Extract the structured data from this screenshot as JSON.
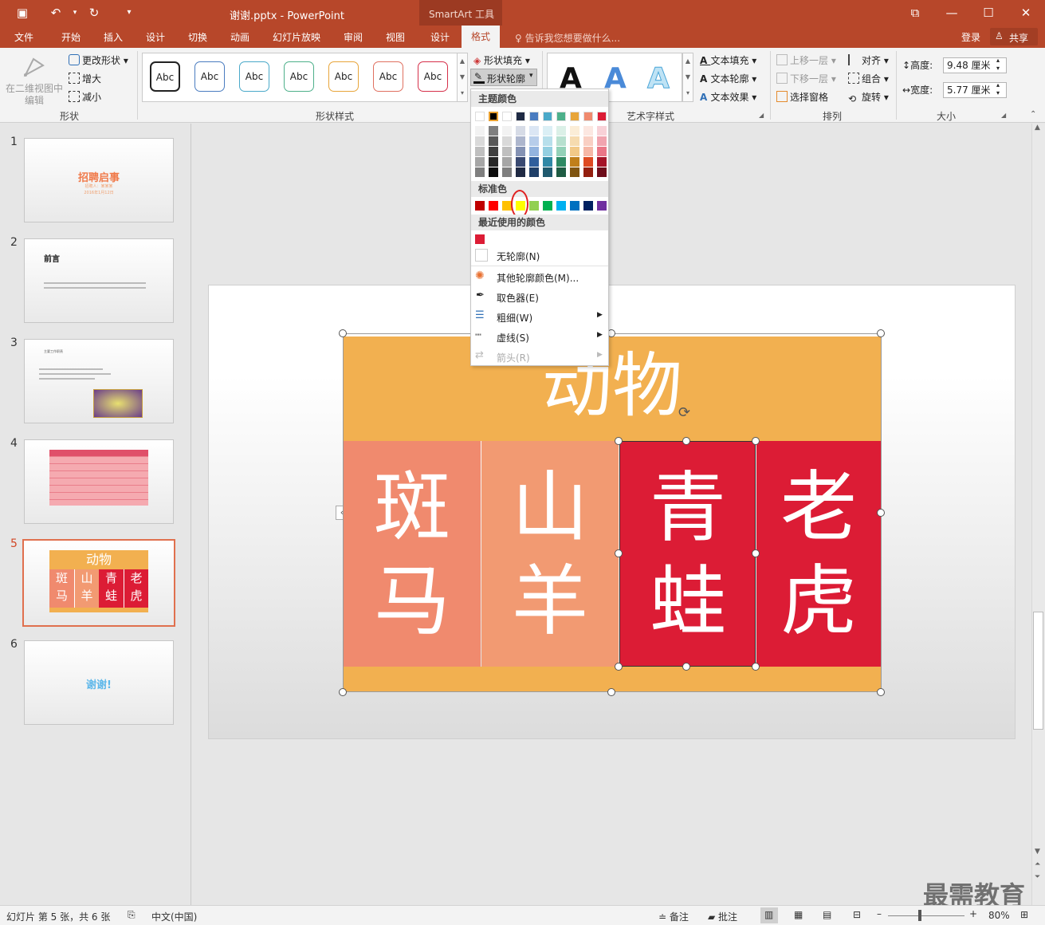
{
  "window": {
    "title": "谢谢.pptx - PowerPoint",
    "context_tab": "SmartArt 工具"
  },
  "tabs": [
    "文件",
    "开始",
    "插入",
    "设计",
    "切换",
    "动画",
    "幻灯片放映",
    "审阅",
    "视图",
    "设计",
    "格式"
  ],
  "tell_me": "告诉我您想要做什么...",
  "login": "登录",
  "share": "共享",
  "ribbon": {
    "shape_group": {
      "edit_2d": "在二维视图中编辑",
      "change_shape": "更改形状",
      "enlarge": "增大",
      "shrink": "减小",
      "label": "形状"
    },
    "shape_styles": {
      "samples": [
        "Abc",
        "Abc",
        "Abc",
        "Abc",
        "Abc",
        "Abc",
        "Abc"
      ],
      "label": "形状样式",
      "fill": "形状填充",
      "outline": "形状轮廓"
    },
    "art_styles": {
      "letters": [
        "A",
        "A",
        "A"
      ],
      "text_fill": "文本填充",
      "text_outline": "文本轮廓",
      "text_effect": "文本效果",
      "label": "艺术字样式"
    },
    "arrange": {
      "bring_forward": "上移一层",
      "send_backward": "下移一层",
      "selection_pane": "选择窗格",
      "align": "对齐",
      "group": "组合",
      "rotate": "旋转",
      "label": "排列"
    },
    "size": {
      "height_label": "高度:",
      "height_value": "9.48 厘米",
      "width_label": "宽度:",
      "width_value": "5.77 厘米",
      "label": "大小"
    }
  },
  "thumbnails": [
    {
      "num": "1",
      "title": "招聘启事",
      "sub1": "招聘人：某某某",
      "sub2": "2016年1月12日"
    },
    {
      "num": "2",
      "title": "前言"
    },
    {
      "num": "3",
      "title": "主要工作职责"
    },
    {
      "num": "4"
    },
    {
      "num": "5",
      "title": "动物",
      "cells": [
        "斑",
        "山",
        "青",
        "老",
        "马",
        "羊",
        "蛙",
        "虎"
      ]
    },
    {
      "num": "6",
      "title": "谢谢!"
    }
  ],
  "slide": {
    "title": "动物",
    "columns": [
      {
        "top": "斑",
        "bottom": "马"
      },
      {
        "top": "山",
        "bottom": "羊"
      },
      {
        "top": "青",
        "bottom": "蛙"
      },
      {
        "top": "老",
        "bottom": "虎"
      }
    ]
  },
  "menu": {
    "theme_colors": "主题颜色",
    "standard_colors": "标准色",
    "recent_colors": "最近使用的颜色",
    "no_outline": "无轮廓(N)",
    "more_colors": "其他轮廓颜色(M)...",
    "eyedropper": "取色器(E)",
    "weight": "粗细(W)",
    "dashes": "虚线(S)",
    "arrows": "箭头(R)"
  },
  "status": {
    "slide_info": "幻灯片 第 5 张，共 6 张",
    "language": "中文(中国)",
    "notes": "备注",
    "comments": "批注",
    "zoom": "80%"
  },
  "watermark": "最需教育",
  "colors": {
    "accent": "#b7472a",
    "orange_header": "#f2b050",
    "salmon": "#f08a6e",
    "red": "#dc1c35"
  }
}
